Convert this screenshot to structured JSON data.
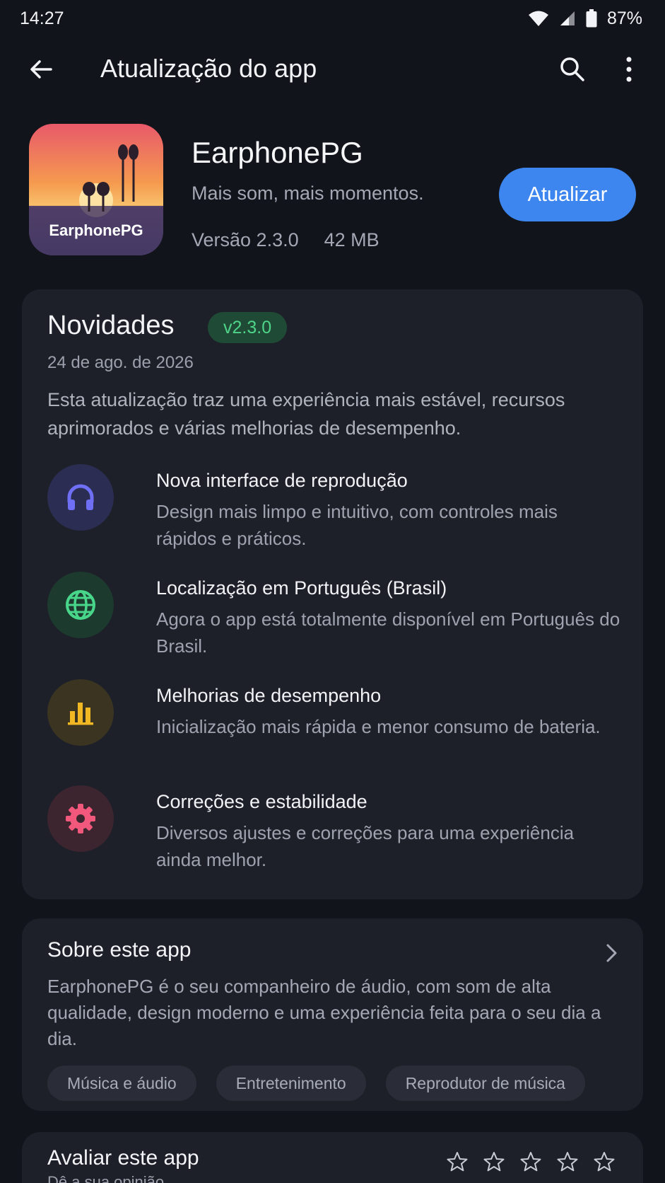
{
  "status_bar": {
    "time": "14:27",
    "battery": "87%"
  },
  "app_bar": {
    "title": "Atualização do app"
  },
  "app": {
    "name": "EarphonePG",
    "tagline": "Mais som, mais momentos.",
    "version": "Versão 2.3.0",
    "size": "42 MB",
    "update_label": "Atualizar",
    "icon_text": "EarphonePG"
  },
  "news": {
    "title": "Novidades",
    "badge": "v2.3.0",
    "date": "24 de ago. de 2026",
    "description": "Esta atualização traz uma experiência mais estável, recursos aprimorados e várias melhorias de desempenho.",
    "features": [
      {
        "icon": "headphones-icon",
        "color": "#6f6ff5",
        "title": "Nova interface de reprodução",
        "desc": "Design mais limpo e intuitivo, com controles mais rápidos e práticos."
      },
      {
        "icon": "globe-icon",
        "color": "#48d68a",
        "title": "Localização em Português (Brasil)",
        "desc": "Agora o app está totalmente disponível em Português do Brasil."
      },
      {
        "icon": "bar-chart-icon",
        "color": "#f2b824",
        "title": "Melhorias de desempenho",
        "desc": "Inicialização mais rápida e menor consumo de bateria."
      },
      {
        "icon": "gear-icon",
        "color": "#f1587c",
        "title": "Correções e estabilidade",
        "desc": "Diversos ajustes e correções para uma experiência ainda melhor."
      }
    ]
  },
  "about": {
    "title": "Sobre este app",
    "description": "EarphonePG é o seu companheiro de áudio, com som de alta qualidade, design moderno e uma experiência feita para o seu dia a dia.",
    "chips": [
      "Música e áudio",
      "Entretenimento",
      "Reprodutor de música"
    ]
  },
  "rate": {
    "title": "Avaliar este app",
    "subtitle": "Dê a sua opinião"
  }
}
